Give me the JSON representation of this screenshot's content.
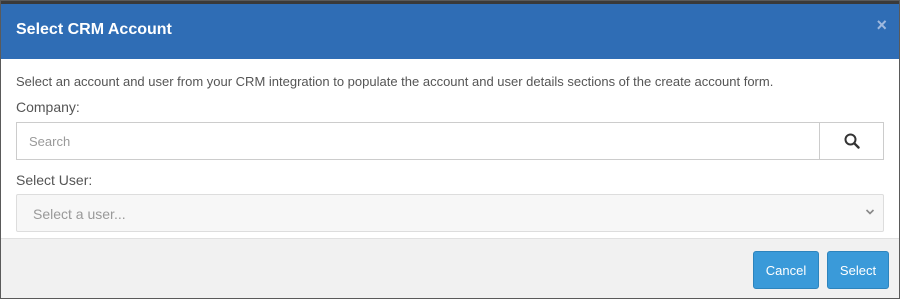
{
  "dialog": {
    "title": "Select CRM Account",
    "close_glyph": "×",
    "description": "Select an account and user from your CRM integration to populate the account and user details sections of the create account form.",
    "company_label": "Company:",
    "search": {
      "placeholder": "Search",
      "value": "",
      "button_icon": "search-icon"
    },
    "user_label": "Select User:",
    "user_select": {
      "selected": "Select a user...",
      "disabled": true
    },
    "footer": {
      "cancel_label": "Cancel",
      "select_label": "Select"
    }
  },
  "colors": {
    "header_bg": "#2f6db5",
    "primary_button": "#3a9ad9",
    "footer_bg": "#f1f1f1"
  }
}
